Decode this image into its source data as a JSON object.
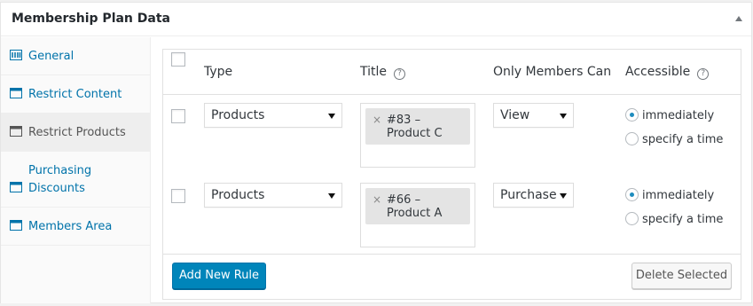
{
  "metabox": {
    "title": "Membership Plan Data"
  },
  "tabs": [
    {
      "label": "General",
      "icon": "grid-icon",
      "active": false
    },
    {
      "label": "Restrict Content",
      "icon": "window-icon",
      "active": false
    },
    {
      "label": "Restrict Products",
      "icon": "window-icon",
      "active": true
    },
    {
      "label": "Purchasing Discounts",
      "icon": "window-icon",
      "active": false
    },
    {
      "label": "Members Area",
      "icon": "window-icon",
      "active": false
    }
  ],
  "table": {
    "columns": {
      "type": "Type",
      "title": "Title",
      "only_members_can": "Only Members Can",
      "accessible": "Accessible"
    },
    "rows": [
      {
        "type": "Products",
        "title_token": "#83 – Product C",
        "only_members_can": "View",
        "accessible_options": [
          "immediately",
          "specify a time"
        ],
        "accessible_selected": "immediately"
      },
      {
        "type": "Products",
        "title_token": "#66 – Product A",
        "only_members_can": "Purchase",
        "accessible_options": [
          "immediately",
          "specify a time"
        ],
        "accessible_selected": "immediately"
      }
    ]
  },
  "footer": {
    "add_label": "Add New Rule",
    "delete_label": "Delete Selected"
  },
  "colors": {
    "primary_button": "#0085ba",
    "link": "#0073aa"
  }
}
